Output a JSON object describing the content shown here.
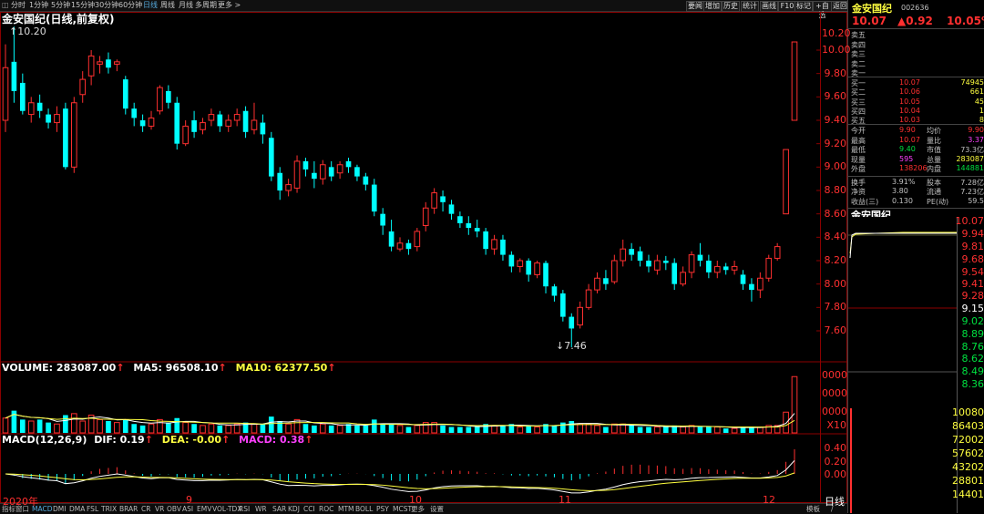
{
  "toolbar": {
    "items": [
      "分时",
      "1分钟",
      "5分钟",
      "15分钟",
      "30分钟",
      "60分钟",
      "日线",
      "周线",
      "月线",
      "多周期",
      "更多 >"
    ],
    "active": "日线",
    "right_buttons": [
      "要闻",
      "增加",
      "历史",
      "统计",
      "画线",
      "F10",
      "标记",
      "+自选",
      "返回"
    ]
  },
  "chart": {
    "title": "金安国纪(日线,前复权)",
    "high_label": "10.20",
    "low_label": "7.46",
    "y_ticks": [
      "10.20",
      "10.00",
      "9.80",
      "9.60",
      "9.40",
      "9.20",
      "9.00",
      "8.80",
      "8.60",
      "8.40",
      "8.20",
      "8.00",
      "7.80",
      "7.60"
    ],
    "month_labels": [
      "2020年",
      "9",
      "10",
      "11",
      "12"
    ],
    "period_label": "日线"
  },
  "chart_data": {
    "type": "candlestick",
    "ylim": [
      7.4,
      10.2
    ],
    "candles": [
      [
        9.4,
        9.85,
        9.3,
        10.05
      ],
      [
        9.9,
        9.65,
        9.55,
        10.2
      ],
      [
        9.72,
        9.48,
        9.45,
        9.8
      ],
      [
        9.45,
        9.55,
        9.38,
        9.6
      ],
      [
        9.55,
        9.48,
        9.42,
        9.62
      ],
      [
        9.45,
        9.38,
        9.33,
        9.5
      ],
      [
        9.38,
        9.45,
        9.3,
        9.52
      ],
      [
        9.5,
        9.0,
        8.98,
        9.55
      ],
      [
        9.0,
        9.55,
        8.95,
        9.6
      ],
      [
        9.62,
        9.75,
        9.55,
        9.82
      ],
      [
        9.78,
        9.95,
        9.7,
        10.0
      ],
      [
        9.88,
        9.9,
        9.8,
        9.95
      ],
      [
        9.92,
        9.85,
        9.8,
        9.98
      ],
      [
        9.88,
        9.9,
        9.82,
        9.92
      ],
      [
        9.75,
        9.5,
        9.45,
        9.78
      ],
      [
        9.5,
        9.42,
        9.35,
        9.55
      ],
      [
        9.4,
        9.35,
        9.3,
        9.45
      ],
      [
        9.35,
        9.42,
        9.32,
        9.48
      ],
      [
        9.48,
        9.68,
        9.45,
        9.7
      ],
      [
        9.65,
        9.55,
        9.5,
        9.7
      ],
      [
        9.55,
        9.2,
        9.15,
        9.6
      ],
      [
        9.2,
        9.35,
        9.18,
        9.4
      ],
      [
        9.4,
        9.3,
        9.25,
        9.48
      ],
      [
        9.32,
        9.38,
        9.28,
        9.42
      ],
      [
        9.4,
        9.45,
        9.35,
        9.5
      ],
      [
        9.45,
        9.35,
        9.3,
        9.48
      ],
      [
        9.35,
        9.4,
        9.3,
        9.45
      ],
      [
        9.4,
        9.45,
        9.35,
        9.5
      ],
      [
        9.48,
        9.3,
        9.25,
        9.52
      ],
      [
        9.32,
        9.4,
        9.28,
        9.55
      ],
      [
        9.38,
        9.28,
        9.2,
        9.45
      ],
      [
        9.25,
        8.92,
        8.88,
        9.3
      ],
      [
        8.95,
        8.8,
        8.72,
        9.0
      ],
      [
        8.8,
        8.85,
        8.75,
        8.9
      ],
      [
        8.82,
        9.05,
        8.78,
        9.1
      ],
      [
        9.05,
        8.98,
        8.92,
        9.08
      ],
      [
        8.95,
        8.9,
        8.82,
        9.05
      ],
      [
        8.9,
        9.02,
        8.85,
        9.06
      ],
      [
        9.0,
        8.92,
        8.88,
        9.05
      ],
      [
        8.95,
        9.02,
        8.9,
        9.05
      ],
      [
        9.05,
        9.0,
        8.95,
        9.08
      ],
      [
        9.0,
        8.92,
        8.88,
        9.02
      ],
      [
        8.92,
        8.85,
        8.8,
        8.95
      ],
      [
        8.85,
        8.62,
        8.58,
        8.9
      ],
      [
        8.6,
        8.5,
        8.42,
        8.65
      ],
      [
        8.45,
        8.32,
        8.28,
        8.55
      ],
      [
        8.3,
        8.35,
        8.28,
        8.4
      ],
      [
        8.35,
        8.3,
        8.25,
        8.38
      ],
      [
        8.32,
        8.45,
        8.28,
        8.48
      ],
      [
        8.5,
        8.65,
        8.45,
        8.7
      ],
      [
        8.65,
        8.78,
        8.6,
        8.82
      ],
      [
        8.75,
        8.7,
        8.62,
        8.8
      ],
      [
        8.68,
        8.6,
        8.55,
        8.72
      ],
      [
        8.58,
        8.52,
        8.48,
        8.62
      ],
      [
        8.52,
        8.48,
        8.42,
        8.58
      ],
      [
        8.48,
        8.45,
        8.4,
        8.55
      ],
      [
        8.45,
        8.3,
        8.25,
        8.48
      ],
      [
        8.3,
        8.38,
        8.25,
        8.42
      ],
      [
        8.38,
        8.25,
        8.2,
        8.42
      ],
      [
        8.25,
        8.15,
        8.1,
        8.28
      ],
      [
        8.15,
        8.2,
        8.1,
        8.22
      ],
      [
        8.2,
        8.08,
        8.02,
        8.22
      ],
      [
        8.08,
        8.18,
        8.05,
        8.2
      ],
      [
        8.18,
        7.98,
        7.92,
        8.2
      ],
      [
        7.98,
        7.9,
        7.85,
        8.0
      ],
      [
        7.92,
        7.72,
        7.68,
        7.95
      ],
      [
        7.72,
        7.62,
        7.46,
        7.75
      ],
      [
        7.65,
        7.8,
        7.62,
        7.85
      ],
      [
        7.8,
        7.95,
        7.78,
        8.0
      ],
      [
        7.95,
        8.05,
        7.92,
        8.1
      ],
      [
        8.05,
        8.0,
        7.95,
        8.12
      ],
      [
        8.02,
        8.2,
        8.0,
        8.25
      ],
      [
        8.2,
        8.3,
        8.15,
        8.38
      ],
      [
        8.3,
        8.25,
        8.2,
        8.35
      ],
      [
        8.28,
        8.2,
        8.15,
        8.32
      ],
      [
        8.2,
        8.15,
        8.1,
        8.25
      ],
      [
        8.12,
        8.2,
        8.08,
        8.25
      ],
      [
        8.2,
        8.18,
        8.12,
        8.24
      ],
      [
        8.18,
        8.0,
        7.95,
        8.22
      ],
      [
        8.0,
        8.1,
        7.98,
        8.15
      ],
      [
        8.1,
        8.25,
        8.05,
        8.28
      ],
      [
        8.25,
        8.2,
        8.15,
        8.35
      ],
      [
        8.2,
        8.1,
        8.05,
        8.25
      ],
      [
        8.1,
        8.15,
        8.05,
        8.2
      ],
      [
        8.15,
        8.12,
        8.08,
        8.18
      ],
      [
        8.12,
        8.15,
        8.08,
        8.2
      ],
      [
        8.08,
        8.0,
        7.95,
        8.12
      ],
      [
        8.0,
        7.95,
        7.85,
        8.05
      ],
      [
        7.95,
        8.05,
        7.88,
        8.1
      ],
      [
        8.05,
        8.22,
        8.02,
        8.25
      ],
      [
        8.22,
        8.32,
        8.2,
        8.35
      ],
      [
        8.6,
        9.15,
        8.6,
        9.15
      ],
      [
        9.4,
        10.07,
        9.4,
        10.07
      ]
    ]
  },
  "volume": {
    "title": "VOLUME: 283087.00",
    "ma5": "MA5: 96508.10",
    "ma10": "MA10: 62377.50",
    "ticks": [
      "0000",
      "0000",
      "0000"
    ],
    "unit": "X10"
  },
  "volume_data": [
    1.0,
    1.5,
    0.9,
    0.8,
    0.9,
    0.7,
    0.6,
    1.2,
    1.3,
    0.8,
    1.2,
    0.9,
    0.8,
    0.7,
    0.9,
    0.6,
    0.5,
    0.6,
    0.9,
    0.7,
    1.0,
    0.7,
    0.6,
    0.5,
    0.6,
    0.5,
    0.5,
    0.6,
    0.7,
    0.6,
    0.6,
    1.1,
    0.8,
    0.6,
    0.9,
    0.6,
    0.5,
    0.6,
    0.5,
    0.5,
    0.6,
    0.5,
    0.5,
    0.9,
    0.6,
    0.6,
    0.5,
    0.4,
    0.5,
    0.7,
    0.7,
    0.5,
    0.4,
    0.4,
    0.4,
    0.4,
    0.6,
    0.5,
    0.5,
    0.6,
    0.4,
    0.5,
    0.4,
    0.6,
    0.5,
    0.7,
    0.8,
    0.6,
    0.6,
    0.5,
    0.4,
    0.6,
    0.6,
    0.5,
    0.4,
    0.4,
    0.4,
    0.4,
    0.5,
    0.4,
    0.5,
    0.4,
    0.4,
    0.4,
    0.3,
    0.3,
    0.4,
    0.4,
    0.4,
    0.5,
    0.5,
    1.4,
    3.8
  ],
  "macd": {
    "title": "MACD(12,26,9)",
    "dif": "DIF: 0.19",
    "dea": "DEA: -0.00",
    "macd": "MACD: 0.38",
    "ticks": [
      "0.40",
      "0.20",
      "0.00"
    ]
  },
  "bottom_tabs": [
    "指标",
    "窗口",
    "MACD",
    "DMI",
    "DMA",
    "FSL",
    "TRIX",
    "BRAR",
    "CR",
    "VR",
    "OBV",
    "ASI",
    "EMV",
    "VOL-TDX",
    "RSI",
    "WR",
    "SAR",
    "KDJ",
    "CCI",
    "ROC",
    "MTM",
    "BOLL",
    "PSY",
    "MCST",
    "更多",
    "设置"
  ],
  "bottom_right": [
    "模板",
    "/"
  ],
  "quote": {
    "name": "金安国纪",
    "code": "002636",
    "price": "10.07",
    "change": "▲0.92",
    "pct": "10.05%",
    "sell": [
      {
        "label": "卖五",
        "price": "",
        "vol": ""
      },
      {
        "label": "卖四",
        "price": "",
        "vol": ""
      },
      {
        "label": "卖三",
        "price": "",
        "vol": ""
      },
      {
        "label": "卖二",
        "price": "",
        "vol": ""
      },
      {
        "label": "卖一",
        "price": "",
        "vol": ""
      }
    ],
    "buy": [
      {
        "label": "买一",
        "price": "10.07",
        "vol": "74945"
      },
      {
        "label": "买二",
        "price": "10.06",
        "vol": "661"
      },
      {
        "label": "买三",
        "price": "10.05",
        "vol": "45"
      },
      {
        "label": "买四",
        "price": "10.04",
        "vol": "1"
      },
      {
        "label": "买五",
        "price": "10.03",
        "vol": "8"
      }
    ],
    "stats": [
      {
        "l1": "今开",
        "v1": "9.90",
        "l2": "均价",
        "v2": "9.90"
      },
      {
        "l1": "最高",
        "v1": "10.07",
        "l2": "量比",
        "v2": "3.37"
      },
      {
        "l1": "最低",
        "v1": "9.40",
        "l2": "市值",
        "v2": "73.3亿"
      },
      {
        "l1": "现量",
        "v1": "595",
        "l2": "总量",
        "v2": "283087"
      },
      {
        "l1": "外盘",
        "v1": "138206",
        "l2": "内盘",
        "v2": "144881"
      }
    ],
    "stats2": [
      {
        "l1": "换手",
        "v1": "3.91%",
        "l2": "股本",
        "v2": "7.28亿"
      },
      {
        "l1": "净资",
        "v1": "3.80",
        "l2": "流通",
        "v2": "7.23亿"
      },
      {
        "l1": "收益(三)",
        "v1": "0.130",
        "l2": "PE(动)",
        "v2": "59.5"
      }
    ],
    "mini_title": "金安国纪",
    "mini_prices": [
      "10.07",
      "9.94",
      "9.81",
      "9.68",
      "9.54",
      "9.41",
      "9.28",
      "9.15",
      "9.02",
      "8.89",
      "8.76",
      "8.62",
      "8.49",
      "8.36"
    ],
    "mini_vols": [
      "10080",
      "86403",
      "72002",
      "57602",
      "43202",
      "28801",
      "14401"
    ]
  }
}
